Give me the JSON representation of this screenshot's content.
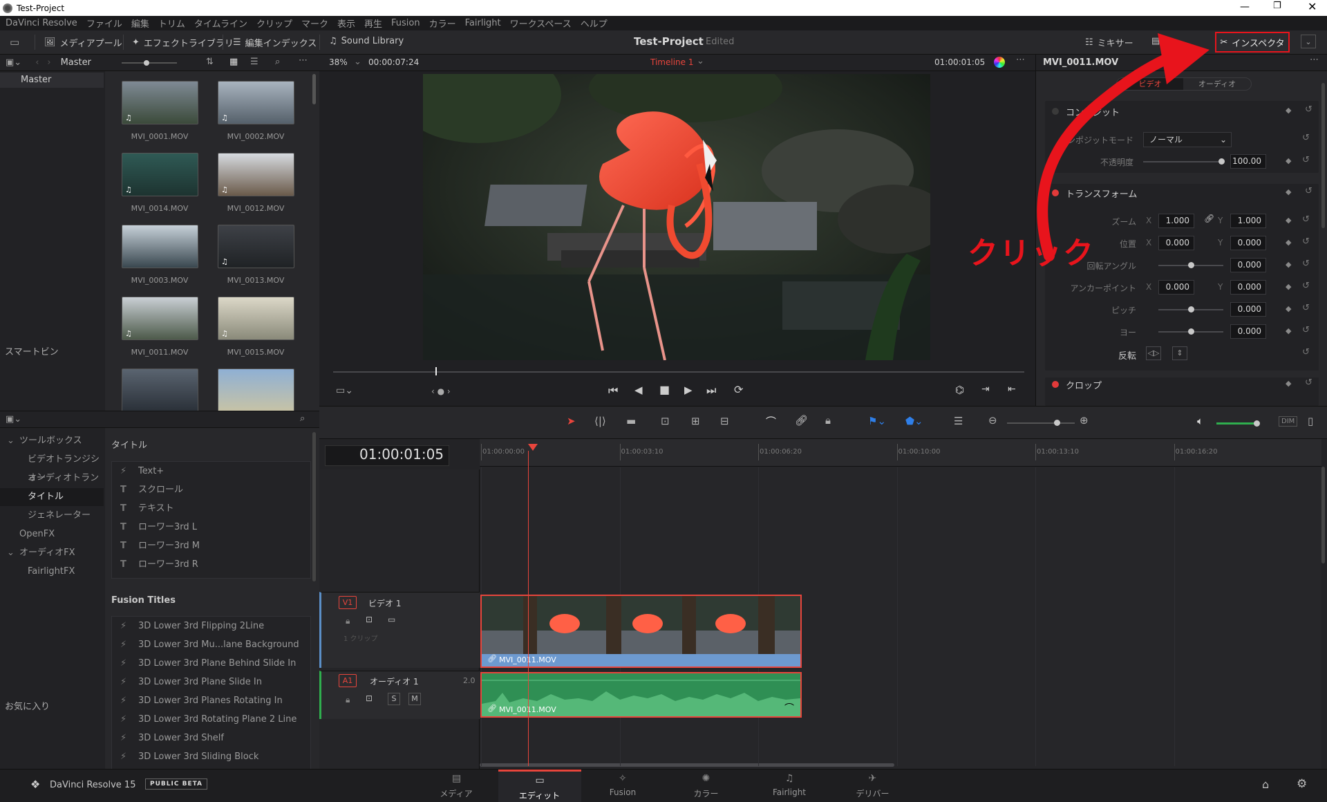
{
  "window": {
    "title": "Test-Project"
  },
  "menu": [
    "DaVinci Resolve",
    "ファイル",
    "編集",
    "トリム",
    "タイムライン",
    "クリップ",
    "マーク",
    "表示",
    "再生",
    "Fusion",
    "カラー",
    "Fairlight",
    "ワークスペース",
    "ヘルプ"
  ],
  "toolbar": {
    "media_pool": "メディアプール",
    "effects_library": "エフェクトライブラリ",
    "edit_index": "編集インデックス",
    "sound_library": "Sound Library",
    "project_name": "Test-Project",
    "project_status": "Edited",
    "mixer": "ミキサー",
    "inspector": "インスペクタ"
  },
  "media_pool": {
    "bin": "Master",
    "master_label": "Master",
    "smart_bins": "スマートビン",
    "clips": [
      "MVI_0001.MOV",
      "MVI_0002.MOV",
      "MVI_0014.MOV",
      "MVI_0012.MOV",
      "MVI_0003.MOV",
      "MVI_0013.MOV",
      "MVI_0011.MOV",
      "MVI_0015.MOV",
      "",
      ""
    ]
  },
  "effects": {
    "tree": [
      {
        "label": "ツールボックス",
        "level": 0,
        "expanded": true
      },
      {
        "label": "ビデオトランジション",
        "level": 1
      },
      {
        "label": "オーディオトランジ...",
        "level": 1
      },
      {
        "label": "タイトル",
        "level": 1,
        "selected": true
      },
      {
        "label": "ジェネレーター",
        "level": 1
      },
      {
        "label": "OpenFX",
        "level": 0
      },
      {
        "label": "オーディオFX",
        "level": 0,
        "expanded": true
      },
      {
        "label": "FairlightFX",
        "level": 1
      }
    ],
    "favorites": "お気に入り",
    "titles_header": "タイトル",
    "titles": [
      {
        "icon": "⚡",
        "label": "Text+"
      },
      {
        "icon": "T",
        "label": "スクロール"
      },
      {
        "icon": "T",
        "label": "テキスト"
      },
      {
        "icon": "T",
        "label": "ローワー3rd L"
      },
      {
        "icon": "T",
        "label": "ローワー3rd M"
      },
      {
        "icon": "T",
        "label": "ローワー3rd R"
      }
    ],
    "fusion_titles_header": "Fusion Titles",
    "fusion_titles": [
      "3D Lower 3rd Flipping 2Line",
      "3D Lower 3rd Mu...lane Background",
      "3D Lower 3rd Plane Behind Slide In",
      "3D Lower 3rd Plane Slide In",
      "3D Lower 3rd Planes Rotating In",
      "3D Lower 3rd Rotating Plane 2 Line",
      "3D Lower 3rd Shelf",
      "3D Lower 3rd Sliding Block"
    ]
  },
  "viewer": {
    "zoom": "38%",
    "duration": "00:00:07:24",
    "timeline_name": "Timeline 1",
    "timecode": "01:00:01:05"
  },
  "inspector": {
    "clip_name": "MVI_0011.MOV",
    "tabs": [
      "ビデオ",
      "オーディオ"
    ],
    "composite": {
      "title": "コンポジット",
      "mode_label": "コンポジットモード",
      "mode_value": "ノーマル",
      "opacity_label": "不透明度",
      "opacity_value": "100.00",
      "opacity": 1.0
    },
    "transform": {
      "title": "トランスフォーム",
      "zoom_label": "ズーム",
      "zoom_x": "1.000",
      "zoom_y": "1.000",
      "position_label": "位置",
      "position_x": "0.000",
      "position_y": "0.000",
      "rotation_label": "回転アングル",
      "rotation_value": "0.000",
      "anchor_label": "アンカーポイント",
      "anchor_x": "0.000",
      "anchor_y": "0.000",
      "pitch_label": "ピッチ",
      "pitch_value": "0.000",
      "yaw_label": "ヨー",
      "yaw_value": "0.000",
      "flip_label": "反転"
    },
    "crop": {
      "title": "クロップ"
    },
    "axis_x": "X",
    "axis_y": "Y"
  },
  "timeline": {
    "timecode": "01:00:01:05",
    "ruler": [
      "01:00:00:00",
      "01:00:03:10",
      "01:00:06:20",
      "01:00:10:00",
      "01:00:13:10",
      "01:00:16:20"
    ],
    "video_track": {
      "id": "V1",
      "name": "ビデオ 1",
      "clip_count": "1 クリップ",
      "clip_name": "MVI_0011.MOV"
    },
    "audio_track": {
      "id": "A1",
      "name": "オーディオ 1",
      "channels": "2.0",
      "solo": "S",
      "mute": "M",
      "clip_name": "MVI_0011.MOV"
    },
    "dim": "DIM"
  },
  "annotation": {
    "text": "クリック",
    "color": "#e8141c"
  },
  "footer": {
    "app": "DaVinci Resolve 15",
    "badge": "PUBLIC BETA",
    "pages": [
      "メディア",
      "エディット",
      "Fusion",
      "カラー",
      "Fairlight",
      "デリバー"
    ],
    "active_page": "エディット"
  },
  "colors": {
    "accent": "#e8453c",
    "audio_clip": "#2f8f54",
    "video_clip_bar": "#5b8fc7"
  }
}
